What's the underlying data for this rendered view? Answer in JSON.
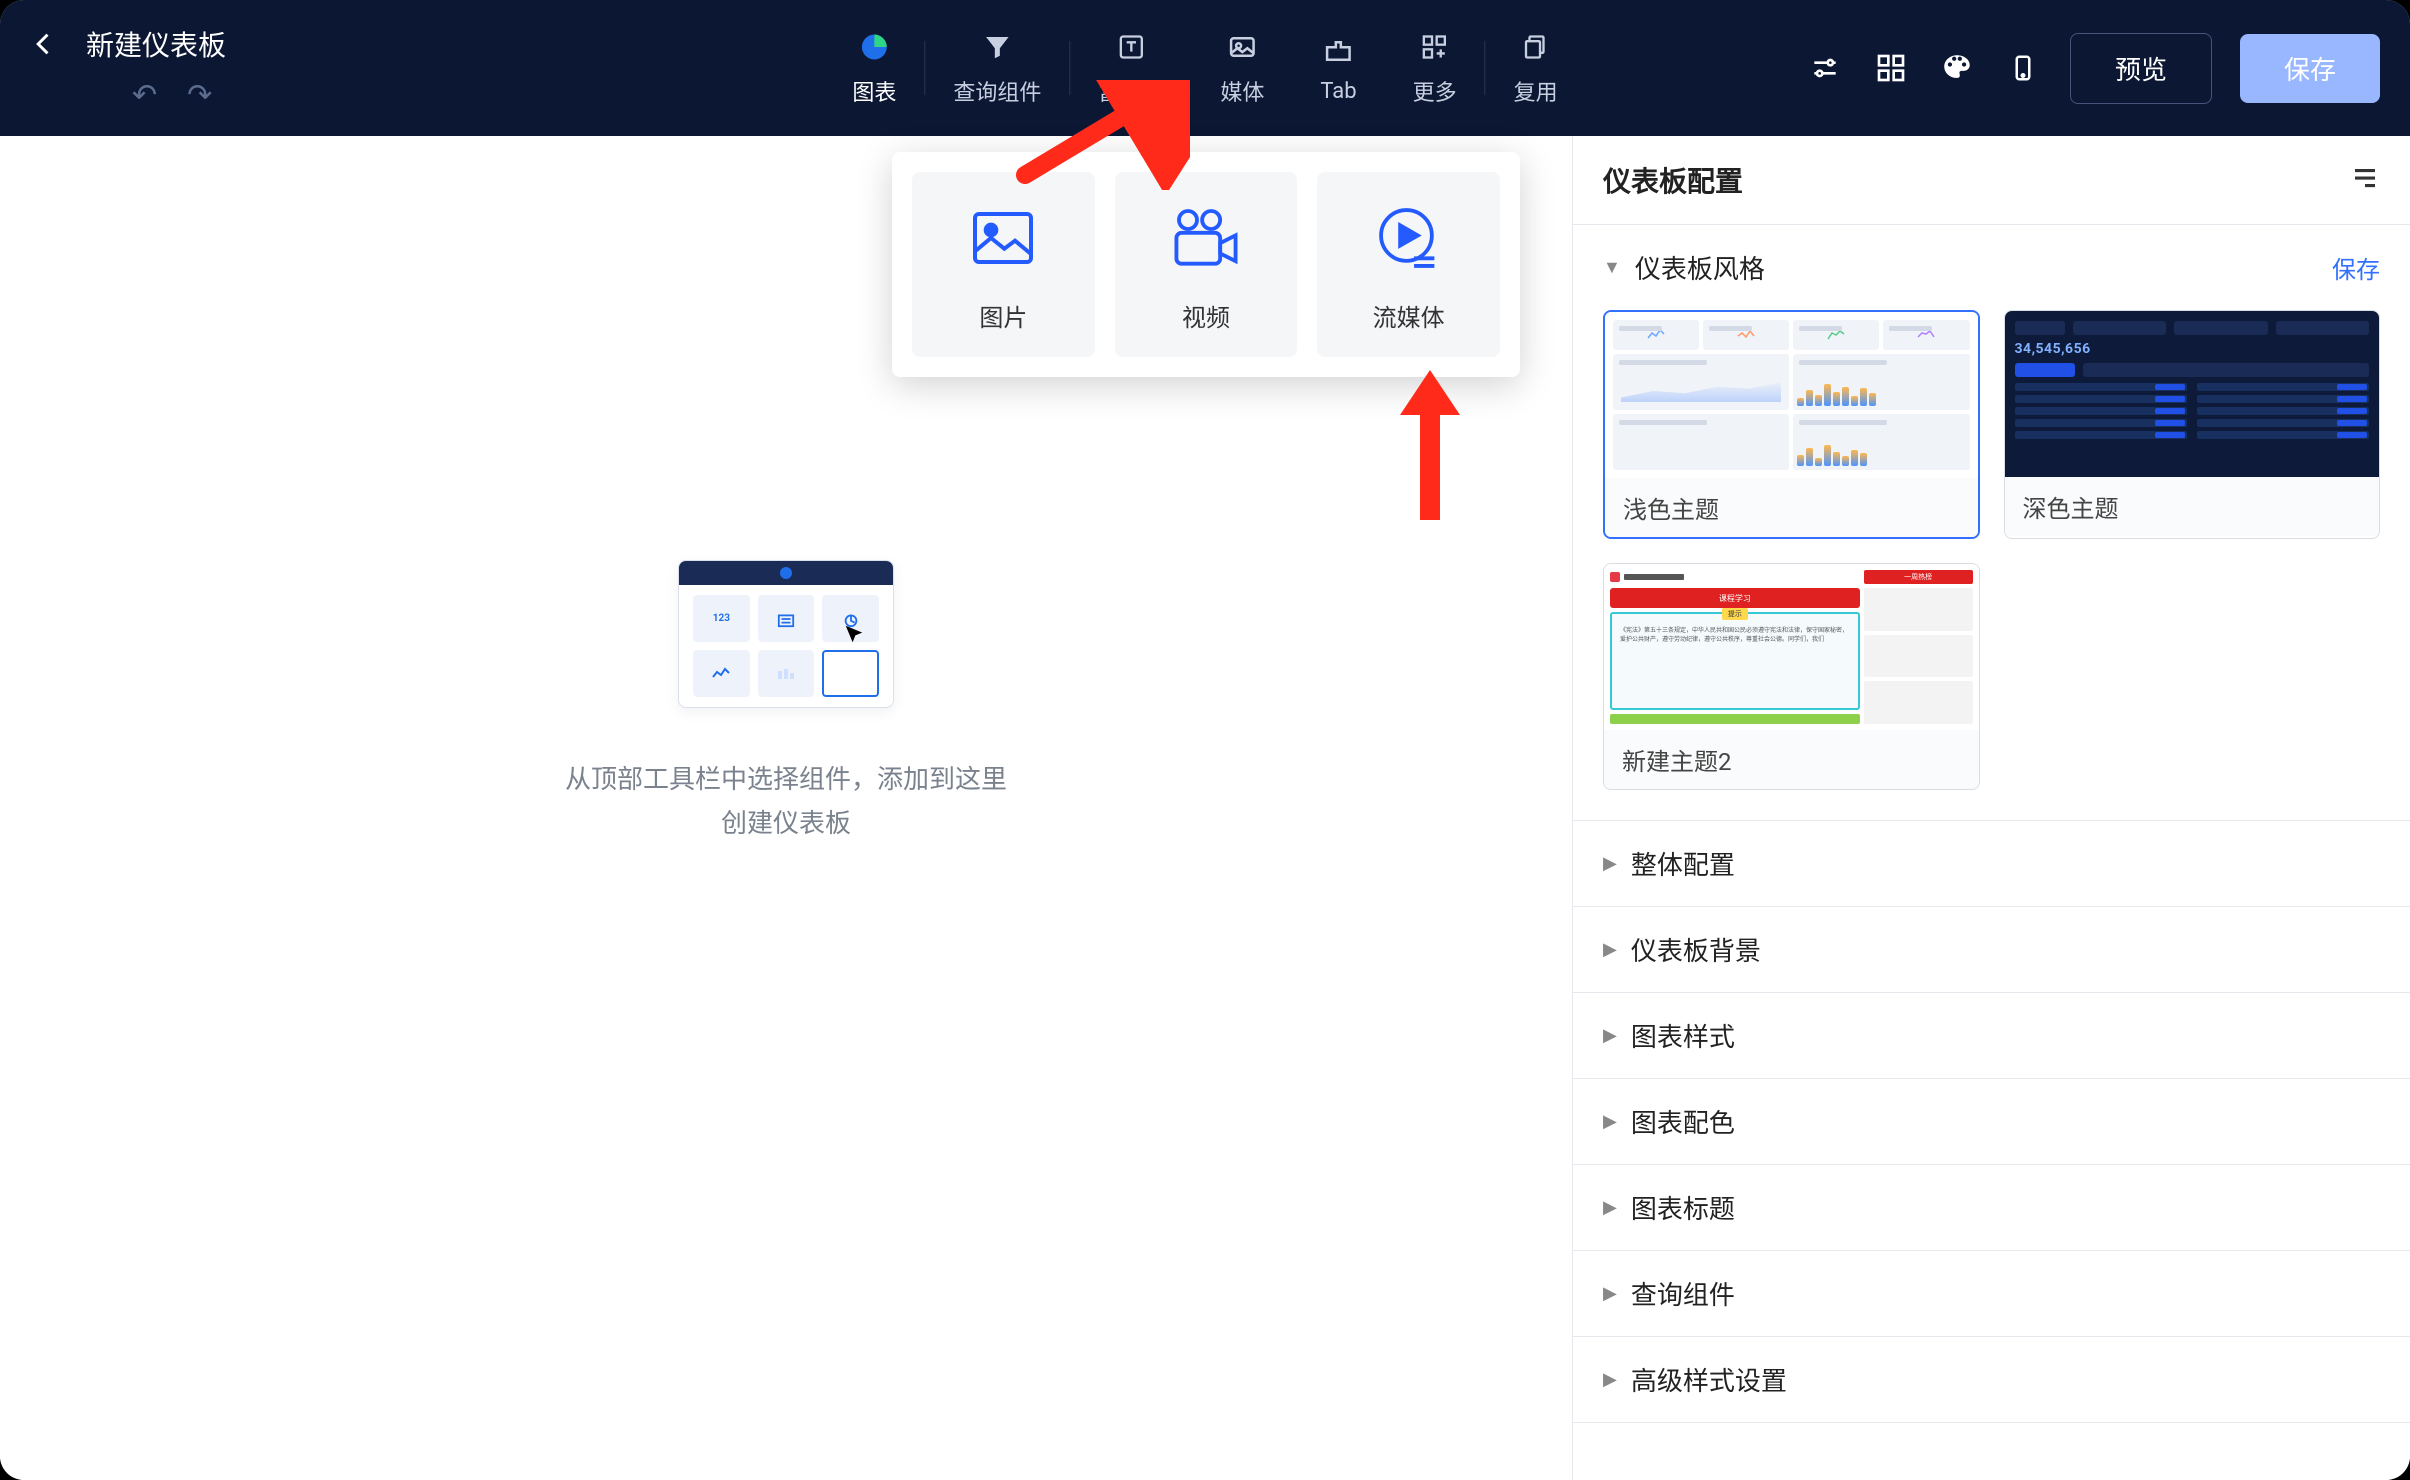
{
  "topbar": {
    "title": "新建仪表板",
    "components": {
      "chart": "图表",
      "query": "查询组件",
      "richtext": "富文本",
      "media": "媒体",
      "tab": "Tab",
      "more": "更多",
      "reuse": "复用"
    },
    "actions": {
      "preview": "预览",
      "save": "保存"
    }
  },
  "mediaDropdown": {
    "image": "图片",
    "video": "视频",
    "stream": "流媒体"
  },
  "canvas": {
    "hint_line1": "从顶部工具栏中选择组件，添加到这里",
    "hint_line2": "创建仪表板",
    "placeholder_number": "123"
  },
  "configPanel": {
    "title": "仪表板配置",
    "styleSection": {
      "title": "仪表板风格",
      "saveLink": "保存",
      "themes": {
        "light": "浅色主题",
        "dark": "深色主题",
        "custom2": "新建主题2"
      },
      "darkPreview": {
        "metric": "34,545,656"
      },
      "customPreview": {
        "bannerText": "课程学习",
        "tagText": "提示",
        "redbarText": "一周热榜"
      }
    },
    "sections": {
      "overall": "整体配置",
      "background": "仪表板背景",
      "chartStyle": "图表样式",
      "chartColor": "图表配色",
      "chartTitle": "图表标题",
      "queryComp": "查询组件",
      "advancedStyle": "高级样式设置"
    }
  }
}
